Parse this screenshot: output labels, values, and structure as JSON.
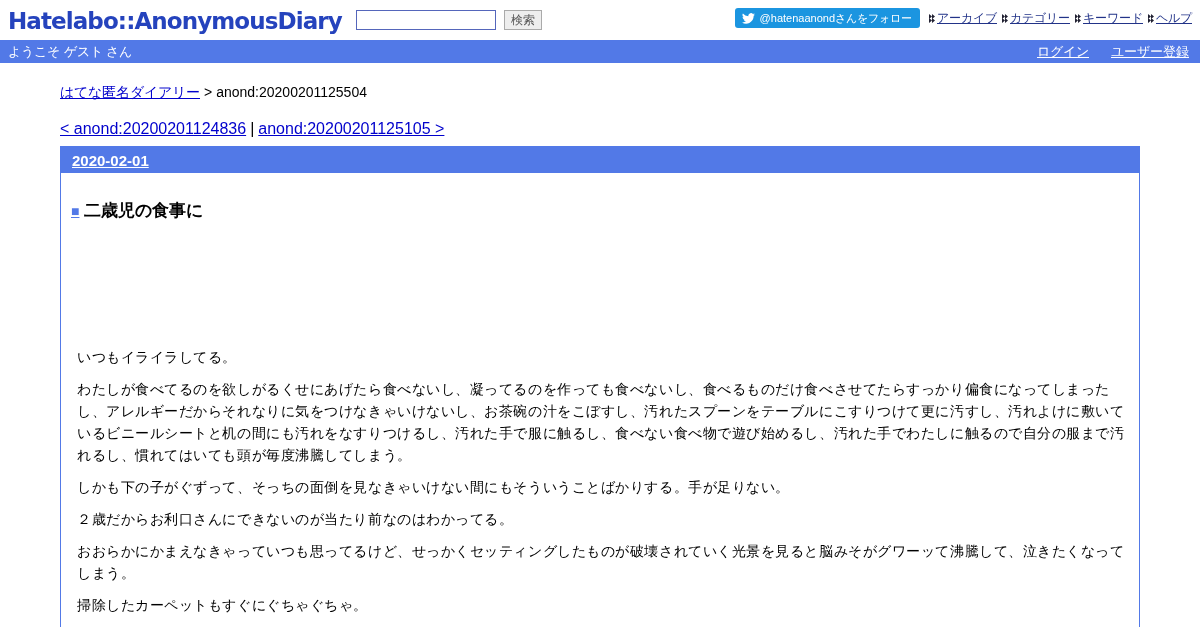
{
  "header": {
    "logo": "Hatelabo::AnonymousDiary",
    "search": {
      "button": "検索"
    },
    "follow_button": "@hatenaanondさんをフォロー",
    "nav_links": [
      "アーカイブ",
      "カテゴリー",
      "キーワード",
      "ヘルプ"
    ]
  },
  "user_bar": {
    "welcome": "ようこそ ゲスト さん",
    "links": [
      "ログイン",
      "ユーザー登録"
    ]
  },
  "breadcrumb": {
    "home": "はてな匿名ダイアリー",
    "separator": ">",
    "current": "anond:20200201125504"
  },
  "pager": {
    "prev": "< anond:20200201124836",
    "separator": "|",
    "next": "anond:20200201125105 >"
  },
  "day": {
    "date": "2020-02-01",
    "title_mark": "■",
    "title": "二歳児の食事に",
    "paragraphs": [
      "いつもイライラしてる。",
      "わたしが食べてるのを欲しがるくせにあげたら食べないし、凝ってるのを作っても食べないし、食べるものだけ食べさせてたらすっかり偏食になってしまったし、アレルギーだからそれなりに気をつけなきゃいけないし、お茶碗の汁をこぼすし、汚れたスプーンをテーブルにこすりつけて更に汚すし、汚れよけに敷いているビニールシートと机の間にも汚れをなすりつけるし、汚れた手で服に触るし、食べない食べ物で遊び始めるし、汚れた手でわたしに触るので自分の服まで汚れるし、慣れてはいても頭が毎度沸騰してしまう。",
      "しかも下の子がぐずって、そっちの面倒を見なきゃいけない間にもそういうことばかりする。手が足りない。",
      "２歳だからお利口さんにできないのが当たり前なのはわかってる。",
      "おおらかにかまえなきゃっていつも思ってるけど、せっかくセッティングしたものが破壊されていく光景を見ると脳みそがグワーッて沸騰して、泣きたくなってしまう。",
      "掃除したカーペットもすぐにぐちゃぐちゃ。"
    ]
  }
}
